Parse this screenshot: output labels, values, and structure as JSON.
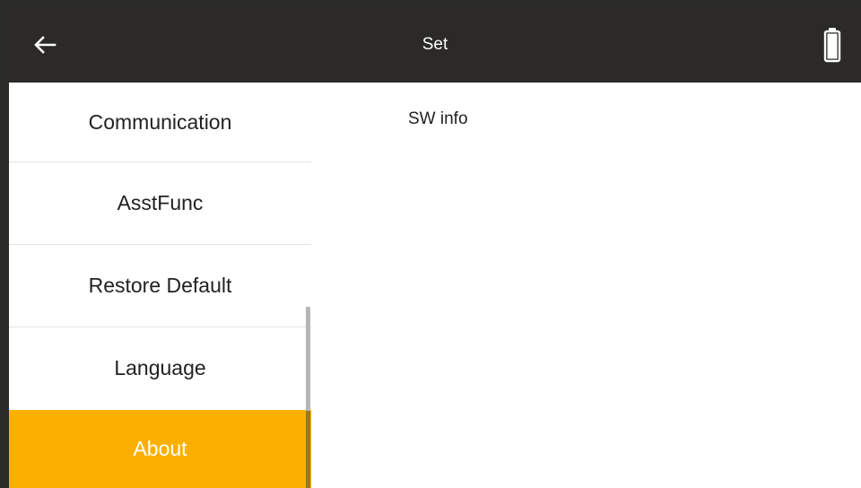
{
  "header": {
    "title": "Set",
    "back_icon": "arrow-left-icon",
    "battery_icon": "battery-icon"
  },
  "sidebar": {
    "items": [
      {
        "label": "Communication"
      },
      {
        "label": "AsstFunc"
      },
      {
        "label": "Restore Default"
      },
      {
        "label": "Language"
      },
      {
        "label": "About",
        "selected": true
      }
    ]
  },
  "content": {
    "title": "SW info"
  },
  "colors": {
    "header_bg": "#2b2a27",
    "accent": "#fbb000",
    "text": "#222222"
  }
}
